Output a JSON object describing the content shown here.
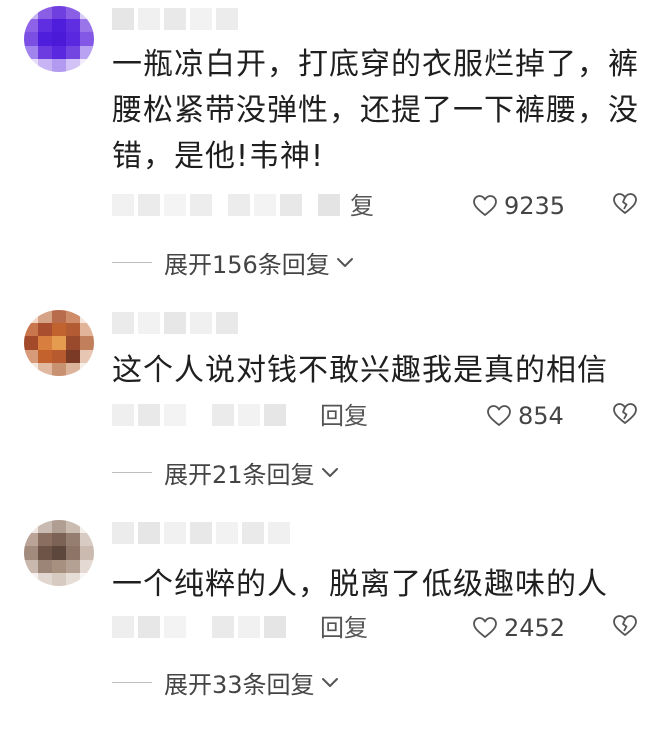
{
  "comments": [
    {
      "content": "一瓶凉白开，打底穿的衣服烂掉了，裤腰松紧带没弹性，还提了一下裤腰，没错，是他!韦神!",
      "reply_label": "复",
      "like_count": "9235",
      "expand_label": "展开156条回复"
    },
    {
      "content": "这个人说对钱不敢兴趣我是真的相信",
      "reply_label": "回复",
      "like_count": "854",
      "expand_label": "展开21条回复"
    },
    {
      "content": "一个纯粹的人，脱离了低级趣味的人",
      "reply_label": "回复",
      "like_count": "2452",
      "expand_label": "展开33条回复"
    }
  ],
  "icons": {
    "like": "heart-outline-icon",
    "dislike": "broken-heart-icon",
    "expand": "chevron-down-icon"
  },
  "colors": {
    "text": "#1f1f1f",
    "secondary": "#444444",
    "divider": "#bdbdbd"
  }
}
